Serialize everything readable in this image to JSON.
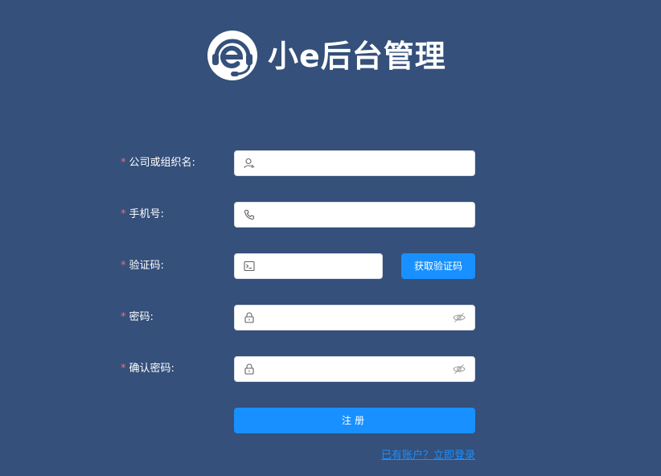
{
  "brand": {
    "title": "小e后台管理",
    "logo_icon": "headset-e-logo"
  },
  "form": {
    "required_mark": "*",
    "fields": [
      {
        "label": "公司或组织名:",
        "value": "",
        "icon": "user-icon"
      },
      {
        "label": "手机号:",
        "value": "",
        "icon": "phone-icon"
      },
      {
        "label": "验证码:",
        "value": "",
        "icon": "message-icon"
      },
      {
        "label": "密码:",
        "value": "",
        "icon": "lock-icon",
        "suffix_icon": "eye-hidden-icon"
      },
      {
        "label": "确认密码:",
        "value": "",
        "icon": "lock-icon",
        "suffix_icon": "eye-hidden-icon"
      }
    ],
    "get_code_label": "获取验证码",
    "submit_label": "注册",
    "login_link": "已有账户？立即登录"
  },
  "colors": {
    "background": "#34507b",
    "primary": "#1890ff",
    "required": "#f56c6c",
    "icon": "#606266"
  }
}
